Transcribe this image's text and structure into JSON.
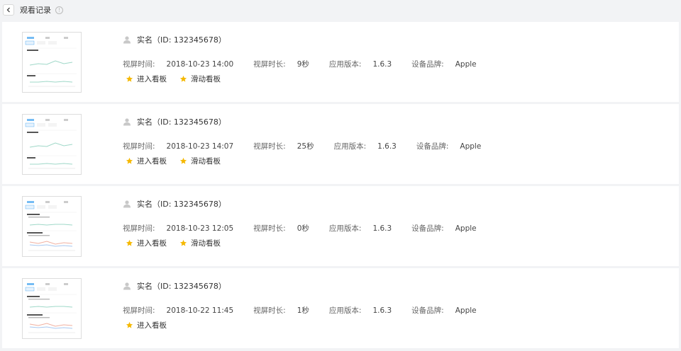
{
  "header": {
    "title": "观看记录"
  },
  "labels": {
    "screen_time": "视屏时间:",
    "duration": "视屏时长:",
    "app_version": "应用版本:",
    "device_brand": "设备品牌:"
  },
  "records": [
    {
      "name": "实名（ID: 132345678）",
      "screen_time": "2018-10-23 14:00",
      "duration": "9秒",
      "app_version": "1.6.3",
      "device_brand": "Apple",
      "actions": [
        "进入看板",
        "滑动看板"
      ],
      "thumb_variant": "a"
    },
    {
      "name": "实名（ID: 132345678）",
      "screen_time": "2018-10-23 14:07",
      "duration": "25秒",
      "app_version": "1.6.3",
      "device_brand": "Apple",
      "actions": [
        "进入看板",
        "滑动看板"
      ],
      "thumb_variant": "a"
    },
    {
      "name": "实名（ID: 132345678）",
      "screen_time": "2018-10-23 12:05",
      "duration": "0秒",
      "app_version": "1.6.3",
      "device_brand": "Apple",
      "actions": [
        "进入看板",
        "滑动看板"
      ],
      "thumb_variant": "b"
    },
    {
      "name": "实名（ID: 132345678）",
      "screen_time": "2018-10-22 11:45",
      "duration": "1秒",
      "app_version": "1.6.3",
      "device_brand": "Apple",
      "actions": [
        "进入看板"
      ],
      "thumb_variant": "b"
    }
  ],
  "colors": {
    "star": "#f5b800",
    "user_icon": "#c8c8c8",
    "accent": "#3aa0f0"
  },
  "icons": {
    "back": "chevron-left-icon",
    "info": "info-circle-icon",
    "user": "user-icon",
    "star": "star-icon"
  }
}
